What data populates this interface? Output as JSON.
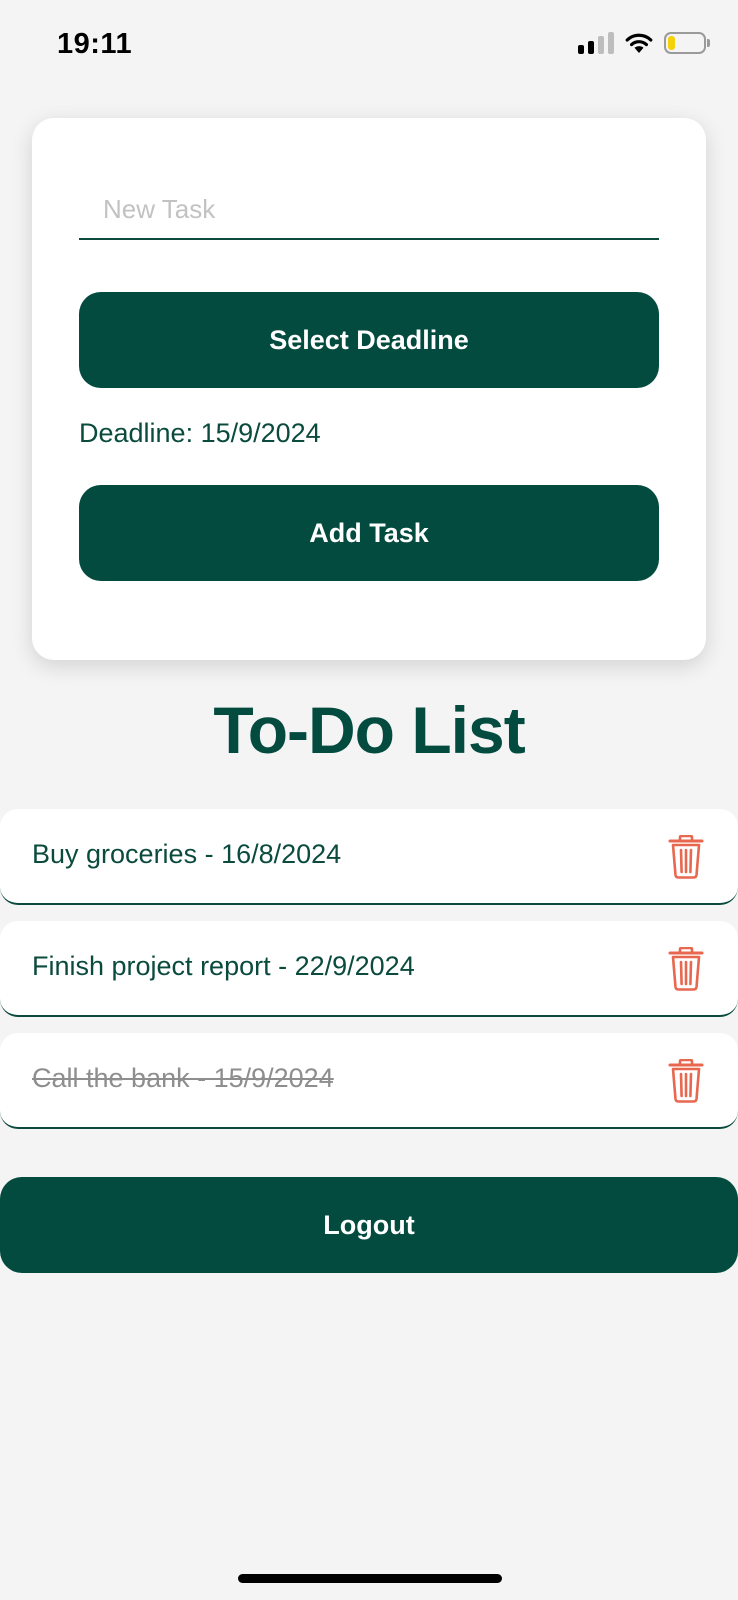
{
  "status_bar": {
    "time": "19:11",
    "signal_icon": "cellular-signal-icon",
    "wifi_icon": "wifi-icon",
    "battery_icon": "battery-icon",
    "battery_level": 0.2,
    "battery_color": "#f5d10a"
  },
  "form": {
    "task_input_placeholder": "New Task",
    "task_input_value": "",
    "select_deadline_label": "Select Deadline",
    "deadline_text": "Deadline: 15/9/2024",
    "add_task_label": "Add Task"
  },
  "list": {
    "title": "To-Do List",
    "items": [
      {
        "text": "Buy groceries - 16/8/2024",
        "completed": false,
        "delete_icon": "trash-icon"
      },
      {
        "text": "Finish project report - 22/9/2024",
        "completed": false,
        "delete_icon": "trash-icon"
      },
      {
        "text": "Call the bank - 15/9/2024",
        "completed": true,
        "delete_icon": "trash-icon"
      }
    ]
  },
  "logout_label": "Logout",
  "colors": {
    "primary": "#034b3f",
    "text": "#0b4b3e",
    "delete": "#e8684f",
    "background": "#f4f4f4",
    "card": "#ffffff",
    "completed_text": "#8e8e8e"
  }
}
